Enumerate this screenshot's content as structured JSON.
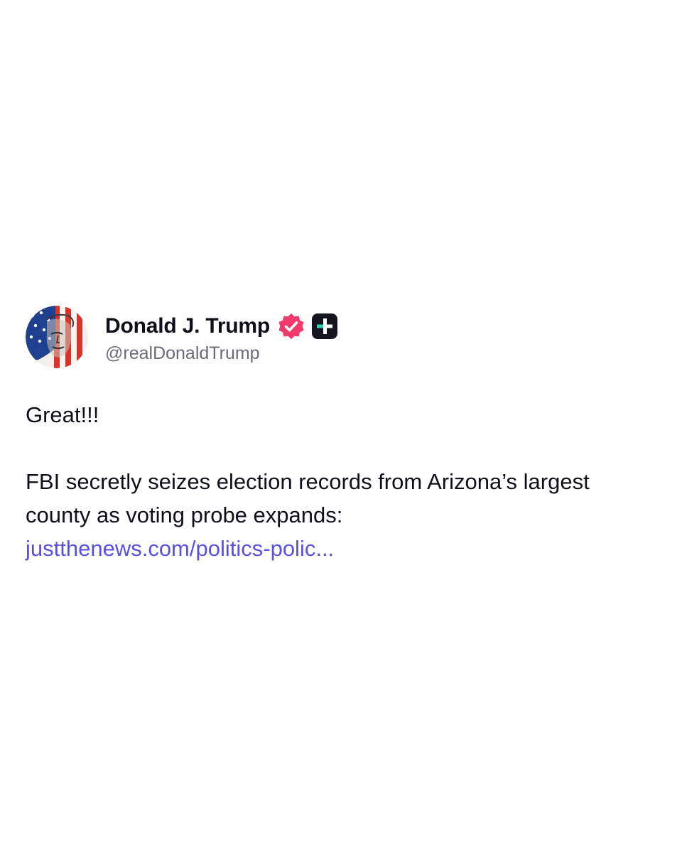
{
  "post": {
    "author": {
      "display_name": "Donald J. Trump",
      "handle": "@realDonaldTrump",
      "avatar_icon": "flag-portrait-avatar",
      "verified_icon": "verified-badge-icon",
      "verified_color": "#f03a6b",
      "plus_icon": "plus-badge-icon"
    },
    "text": {
      "line1": "Great!!!",
      "paragraph": "FBI secretly seizes election records from Arizona’s largest county as voting probe expands:",
      "link": "justthenews.com/politics-polic..."
    },
    "colors": {
      "link": "#5a4fe0",
      "text": "#0f0f1a",
      "muted": "#6b6b78"
    }
  }
}
